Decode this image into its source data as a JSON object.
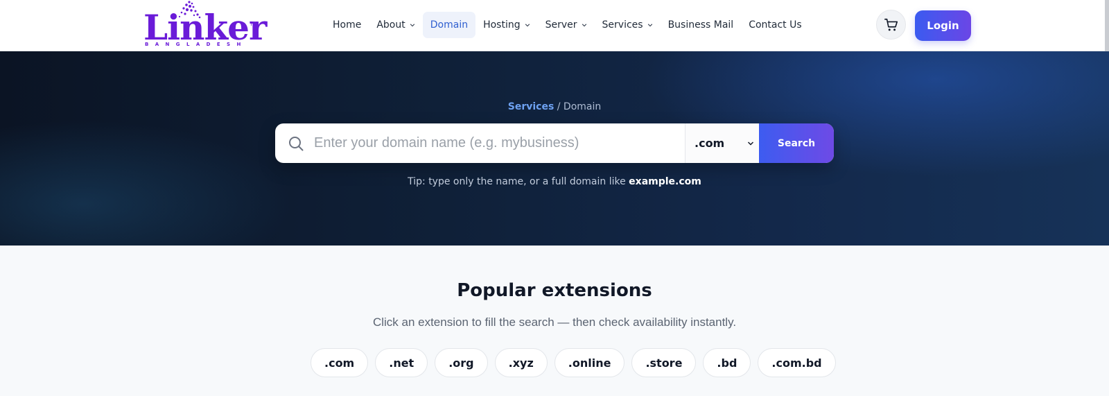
{
  "logo": {
    "word": "Linker",
    "tm": "TM",
    "sub": "BANGLADESH"
  },
  "nav": [
    {
      "label": "Home",
      "dropdown": false,
      "active": false
    },
    {
      "label": "About",
      "dropdown": true,
      "active": false
    },
    {
      "label": "Domain",
      "dropdown": false,
      "active": true
    },
    {
      "label": "Hosting",
      "dropdown": true,
      "active": false
    },
    {
      "label": "Server",
      "dropdown": true,
      "active": false
    },
    {
      "label": "Services",
      "dropdown": true,
      "active": false
    },
    {
      "label": "Business Mail",
      "dropdown": false,
      "active": false
    },
    {
      "label": "Contact Us",
      "dropdown": false,
      "active": false
    }
  ],
  "header": {
    "cart_icon": "cart-icon",
    "login_label": "Login"
  },
  "hero": {
    "crumb_link": "Services",
    "crumb_sep": " / ",
    "crumb_current": "Domain",
    "search_placeholder": "Enter your domain name (e.g. mybusiness)",
    "search_value": "",
    "tld_selected": ".com",
    "search_button": "Search",
    "tip_text": "Tip: type only the name, or a full domain like ",
    "tip_example": "example.com"
  },
  "popular": {
    "title": "Popular extensions",
    "subtitle": "Click an extension to fill the search — then check availability instantly.",
    "extensions": [
      ".com",
      ".net",
      ".org",
      ".xyz",
      ".online",
      ".store",
      ".bd",
      ".com.bd"
    ]
  },
  "colors": {
    "accent": "#3b5bf0",
    "accent2": "#6b46e6",
    "brand": "#6a1bd8",
    "hero_dark": "#0b1424"
  }
}
